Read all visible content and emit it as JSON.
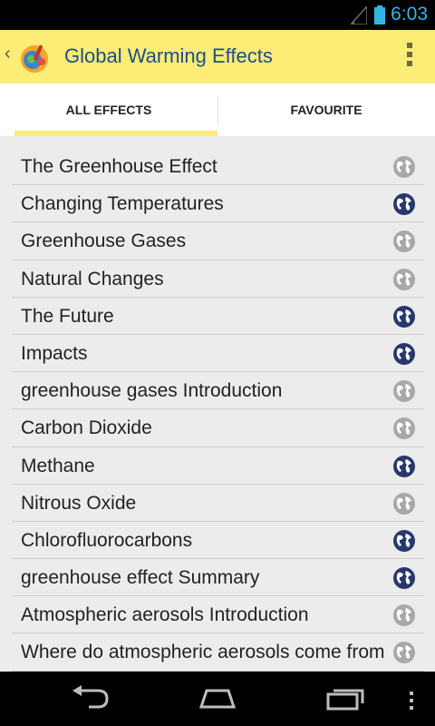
{
  "status_bar": {
    "time": "6:03",
    "accent_color": "#33b5e5"
  },
  "action_bar": {
    "title": "Global Warming Effects",
    "background_color": "#fdec75",
    "icons": [
      "up-caret-icon",
      "app-logo-icon",
      "overflow-menu-icon"
    ]
  },
  "tabs": [
    {
      "label": "ALL EFFECTS",
      "selected": true
    },
    {
      "label": "FAVOURITE",
      "selected": false
    }
  ],
  "list": {
    "items": [
      {
        "label": "The Greenhouse Effect",
        "favourite": false
      },
      {
        "label": "Changing Temperatures",
        "favourite": true
      },
      {
        "label": "Greenhouse Gases",
        "favourite": false
      },
      {
        "label": "Natural Changes",
        "favourite": false
      },
      {
        "label": "The Future",
        "favourite": true
      },
      {
        "label": "Impacts",
        "favourite": true
      },
      {
        "label": "greenhouse gases Introduction",
        "favourite": false
      },
      {
        "label": "Carbon Dioxide",
        "favourite": false
      },
      {
        "label": "Methane",
        "favourite": true
      },
      {
        "label": "Nitrous Oxide",
        "favourite": false
      },
      {
        "label": "Chlorofluorocarbons",
        "favourite": true
      },
      {
        "label": "greenhouse effect Summary",
        "favourite": true
      },
      {
        "label": "Atmospheric aerosols Introduction",
        "favourite": false
      },
      {
        "label": "Where do atmospheric aerosols come from",
        "favourite": false
      }
    ],
    "favourite_icon_color": "#27386b",
    "not_favourite_icon_color": "#a8a8a8"
  },
  "nav_bar": {
    "buttons": [
      "back-icon",
      "home-icon",
      "recent-apps-icon",
      "menu-icon"
    ]
  }
}
